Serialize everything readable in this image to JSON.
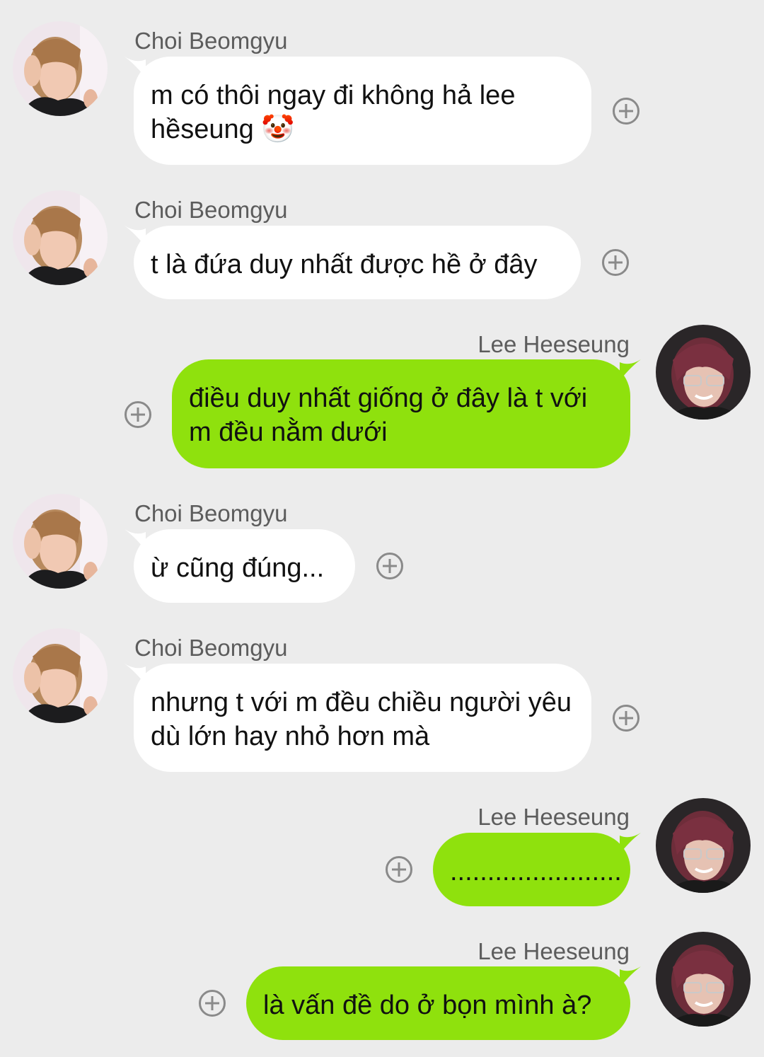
{
  "colors": {
    "background": "#ececec",
    "incoming_bubble": "#ffffff",
    "outgoing_bubble": "#8fe10d",
    "name_text": "#5c5c5c"
  },
  "messages": [
    {
      "sender": "Choi Beomgyu",
      "direction": "incoming",
      "text": "m có thôi ngay đi không hả lee hềseung 🤡",
      "icon": "add-reaction-icon"
    },
    {
      "sender": "Choi Beomgyu",
      "direction": "incoming",
      "text": "t là đứa duy nhất được hề ở đây",
      "icon": "add-reaction-icon"
    },
    {
      "sender": "Lee Heeseung",
      "direction": "outgoing",
      "text": "điều duy nhất giống ở đây là t với m đều nằm dưới",
      "icon": "add-reaction-icon"
    },
    {
      "sender": "Choi Beomgyu",
      "direction": "incoming",
      "text": "ừ cũng đúng...",
      "icon": "add-reaction-icon"
    },
    {
      "sender": "Choi Beomgyu",
      "direction": "incoming",
      "text": "nhưng t với m đều chiều người yêu dù lớn hay nhỏ hơn mà",
      "icon": "add-reaction-icon"
    },
    {
      "sender": "Lee Heeseung",
      "direction": "outgoing",
      "text": ".......................",
      "icon": "add-reaction-icon"
    },
    {
      "sender": "Lee Heeseung",
      "direction": "outgoing",
      "text": "là vấn đề do ở bọn mình à?",
      "icon": "add-reaction-icon"
    }
  ]
}
